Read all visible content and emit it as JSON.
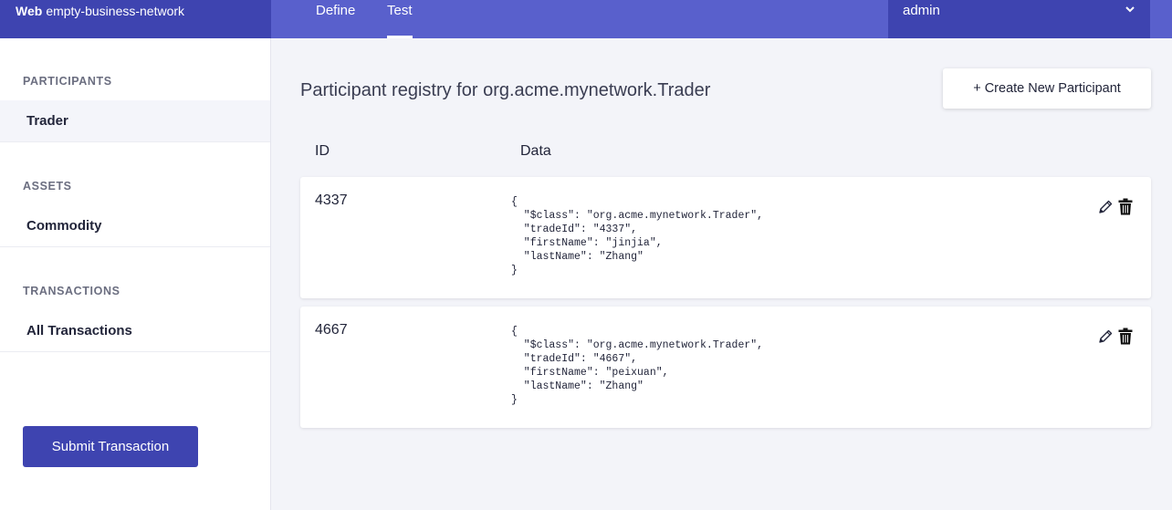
{
  "header": {
    "brand_bold": "Web",
    "brand_name": "empty-business-network",
    "tabs": [
      {
        "label": "Define"
      },
      {
        "label": "Test"
      }
    ],
    "user": "admin"
  },
  "sidebar": {
    "sections": [
      {
        "heading": "PARTICIPANTS",
        "items": [
          {
            "label": "Trader",
            "active": true
          }
        ]
      },
      {
        "heading": "ASSETS",
        "items": [
          {
            "label": "Commodity"
          }
        ]
      },
      {
        "heading": "TRANSACTIONS",
        "items": [
          {
            "label": "All Transactions"
          }
        ]
      }
    ],
    "submit_label": "Submit Transaction"
  },
  "main": {
    "title": "Participant registry for org.acme.mynetwork.Trader",
    "create_label": "+ Create New Participant",
    "columns": [
      "ID",
      "Data"
    ],
    "rows": [
      {
        "id": "4337",
        "data": "{\n  \"$class\": \"org.acme.mynetwork.Trader\",\n  \"tradeId\": \"4337\",\n  \"firstName\": \"jinjia\",\n  \"lastName\": \"Zhang\"\n}"
      },
      {
        "id": "4667",
        "data": "{\n  \"$class\": \"org.acme.mynetwork.Trader\",\n  \"tradeId\": \"4667\",\n  \"firstName\": \"peixuan\",\n  \"lastName\": \"Zhang\"\n}"
      }
    ]
  },
  "colors": {
    "header_bg": "#5960cc",
    "header_dark": "#3e44b0",
    "page_bg": "#f3f4f9"
  }
}
